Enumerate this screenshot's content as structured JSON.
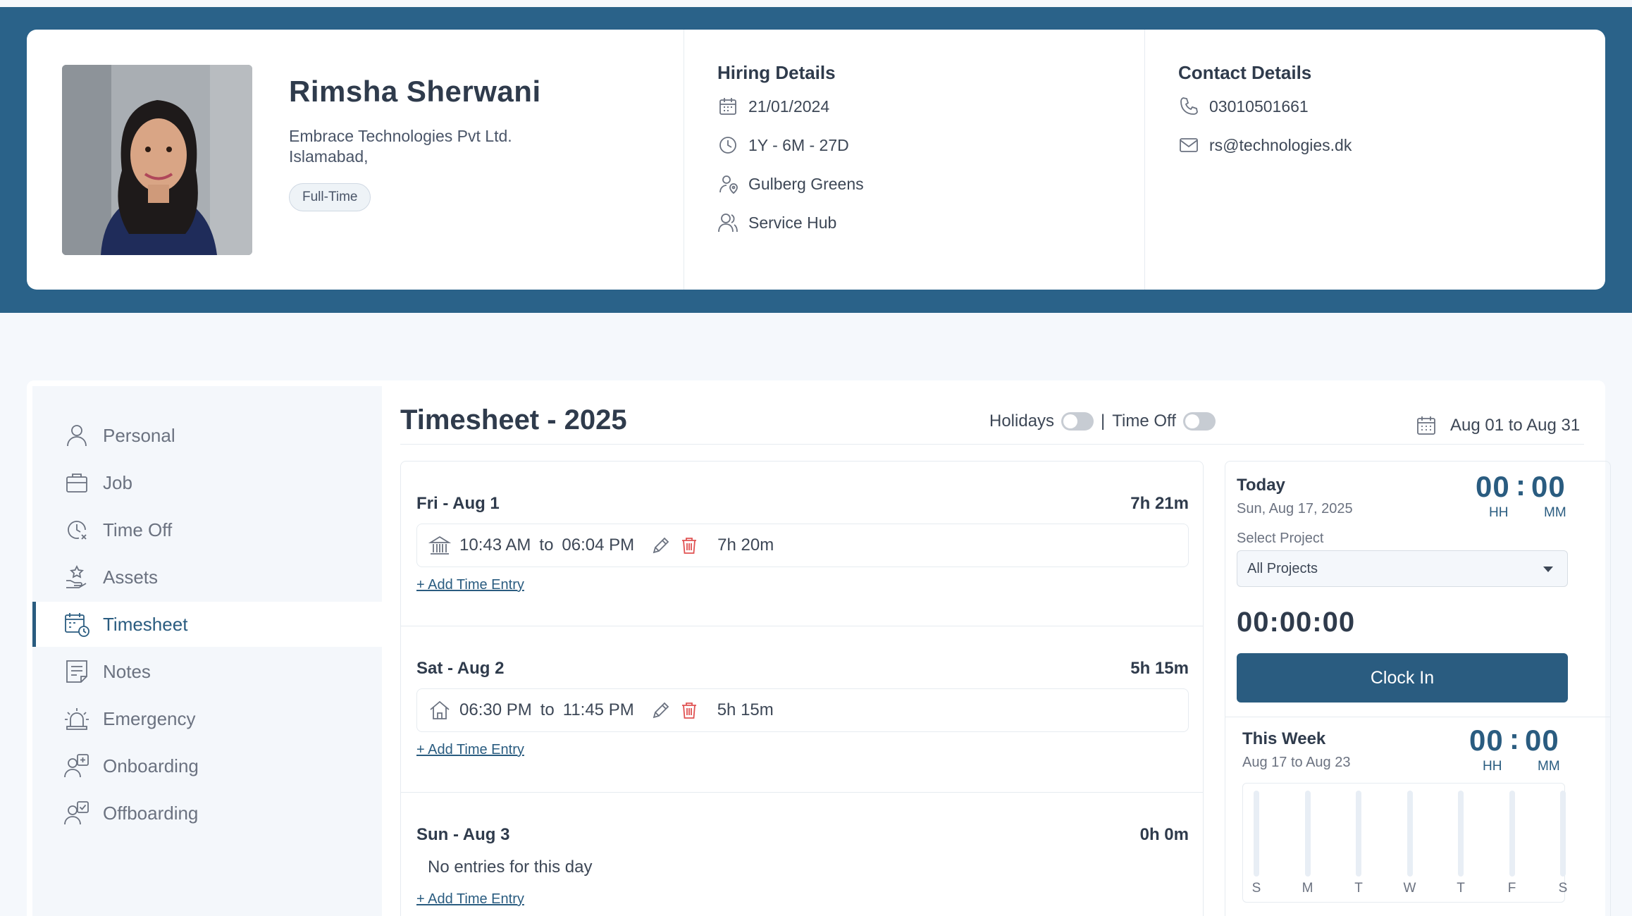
{
  "profile": {
    "name": "Rimsha Sherwani",
    "company": "Embrace Technologies Pvt Ltd.",
    "city": "Islamabad,",
    "employment_type": "Full-Time"
  },
  "hiring": {
    "title": "Hiring Details",
    "date": "21/01/2024",
    "tenure": "1Y - 6M - 27D",
    "location": "Gulberg Greens",
    "department": "Service Hub"
  },
  "contact": {
    "title": "Contact Details",
    "phone": "03010501661",
    "email": "rs@technologies.dk"
  },
  "sidebar": {
    "items": [
      {
        "label": "Personal",
        "icon": "person-icon"
      },
      {
        "label": "Job",
        "icon": "briefcase-icon"
      },
      {
        "label": "Time Off",
        "icon": "clock-x-icon"
      },
      {
        "label": "Assets",
        "icon": "hand-star-icon"
      },
      {
        "label": "Timesheet",
        "icon": "calendar-clock-icon",
        "active": true
      },
      {
        "label": "Notes",
        "icon": "notes-icon"
      },
      {
        "label": "Emergency",
        "icon": "siren-icon"
      },
      {
        "label": "Onboarding",
        "icon": "user-plus-icon"
      },
      {
        "label": "Offboarding",
        "icon": "user-check-icon"
      }
    ]
  },
  "timesheet": {
    "title": "Timesheet - 2025",
    "holidays_label": "Holidays",
    "separator": "|",
    "timeoff_label": "Time Off",
    "range": "Aug 01 to Aug 31",
    "to_word": "to",
    "days": [
      {
        "name": "Fri - Aug 1",
        "total": "7h 21m",
        "entries": [
          {
            "start": "10:43 AM",
            "end": "06:04 PM",
            "duration": "7h 20m",
            "location_icon": "office-building-icon"
          }
        ],
        "add_label": "+ Add Time Entry"
      },
      {
        "name": "Sat - Aug 2",
        "total": "5h 15m",
        "entries": [
          {
            "start": "06:30 PM",
            "end": "11:45 PM",
            "duration": "5h 15m",
            "location_icon": "home-icon"
          }
        ],
        "add_label": "+ Add Time Entry"
      },
      {
        "name": "Sun - Aug 3",
        "total": "0h 0m",
        "empty_text": "No entries for this day",
        "add_label": "+ Add Time Entry"
      }
    ]
  },
  "today": {
    "label": "Today",
    "date": "Sun, Aug 17, 2025",
    "hh": "00",
    "mm": "00",
    "colon": ":",
    "hh_label": "HH",
    "mm_label": "MM",
    "select_label": "Select Project",
    "project": "All Projects",
    "timer": "00:00:00",
    "button": "Clock In"
  },
  "week": {
    "label": "This Week",
    "range": "Aug 17 to Aug 23",
    "hh": "00",
    "mm": "00",
    "colon": ":",
    "hh_label": "HH",
    "mm_label": "MM",
    "days": [
      "S",
      "M",
      "T",
      "W",
      "T",
      "F",
      "S"
    ],
    "values": [
      0,
      0,
      0,
      0,
      0,
      0,
      0
    ]
  },
  "colors": {
    "brand": "#2a6289",
    "accent": "#2a5c80",
    "danger": "#e05252"
  }
}
